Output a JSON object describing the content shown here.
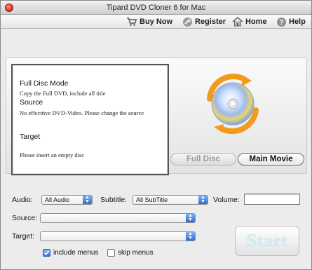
{
  "window": {
    "title": "Tipard DVD Cloner 6 for Mac"
  },
  "toolbar": {
    "buy_now": "Buy Now",
    "register": "Register",
    "home": "Home",
    "help": "Help"
  },
  "info": {
    "mode_title": "Full Disc Mode",
    "mode_desc": "Copy the Full DVD, include all title",
    "source_title": "Source",
    "source_desc": "No effecttive DVD-Video. Please change the source",
    "target_title": "Target",
    "target_desc": "Please insert an empty disc"
  },
  "mode_buttons": {
    "full_disc": "Full Disc",
    "main_movie": "Main Movie"
  },
  "options": {
    "audio_label": "Audio:",
    "audio_value": "All Audio",
    "subtitle_label": "Subtitle:",
    "subtitle_value": "All SubTitle",
    "volume_label": "Volume:",
    "volume_value": "",
    "source_label": "Source:",
    "source_value": "",
    "target_label": "Target:",
    "target_value": ""
  },
  "checkboxes": {
    "include_menus": {
      "label": "include menus",
      "checked": true
    },
    "skip_menus": {
      "label": "skip menus",
      "checked": false
    }
  },
  "start_label": "Start",
  "colors": {
    "accent_blue": "#2a6fd6",
    "disc_orange": "#f29a1c",
    "start_text": "#d7ecf2"
  }
}
